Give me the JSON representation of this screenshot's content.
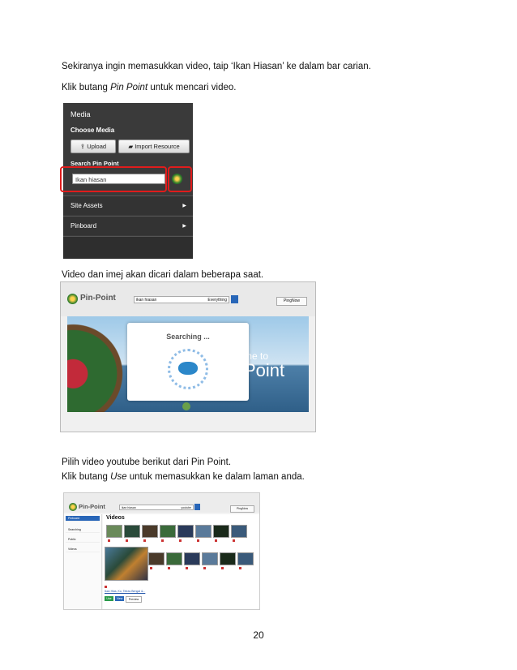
{
  "paragraphs": {
    "p1": "Sekiranya ingin memasukkan video, taip ‘Ikan Hiasan’ ke dalam bar carian.",
    "p2_pre": "Klik butang ",
    "p2_em": "Pin Point",
    "p2_post": " untuk mencari video.",
    "p3": "Video dan imej akan dicari dalam beberapa saat.",
    "p4": "Pilih video youtube berikut dari Pin Point.",
    "p5_pre": "Klik butang ",
    "p5_em": "Use",
    "p5_post": " untuk memasukkan  ke dalam laman anda."
  },
  "media_panel": {
    "title": "Media",
    "choose_media": "Choose Media",
    "upload": "Upload",
    "import_resource": "Import Resource",
    "search_pin_point": "Search Pin Point",
    "search_value": "Ikan hiasan",
    "site_assets": "Site Assets",
    "pinboard": "Pinboard"
  },
  "pinpoint_search": {
    "logo": "Pin-Point",
    "query": "ikan hiasan",
    "filter": "Everything",
    "pin_button": "PingNow",
    "modal_title": "Searching ...",
    "welcome_line1": "me to",
    "welcome_line2": "Point"
  },
  "pinpoint_results": {
    "logo": "Pin-Point",
    "query": "ikan hiasan",
    "filter": "youtube",
    "pin_button": "PingNow",
    "sidebar": [
      "Pinboard",
      "Searching",
      "Public",
      "Videos"
    ],
    "videos_title": "Videos",
    "caption": "Ikan Hias, Ko, Tetras Bengal &...",
    "use_label": "Use",
    "view_label": "View",
    "preview_label": "Preview"
  },
  "page_number": "20",
  "colors": {
    "accent_red": "#e01c1c",
    "link_blue": "#2866b8"
  }
}
